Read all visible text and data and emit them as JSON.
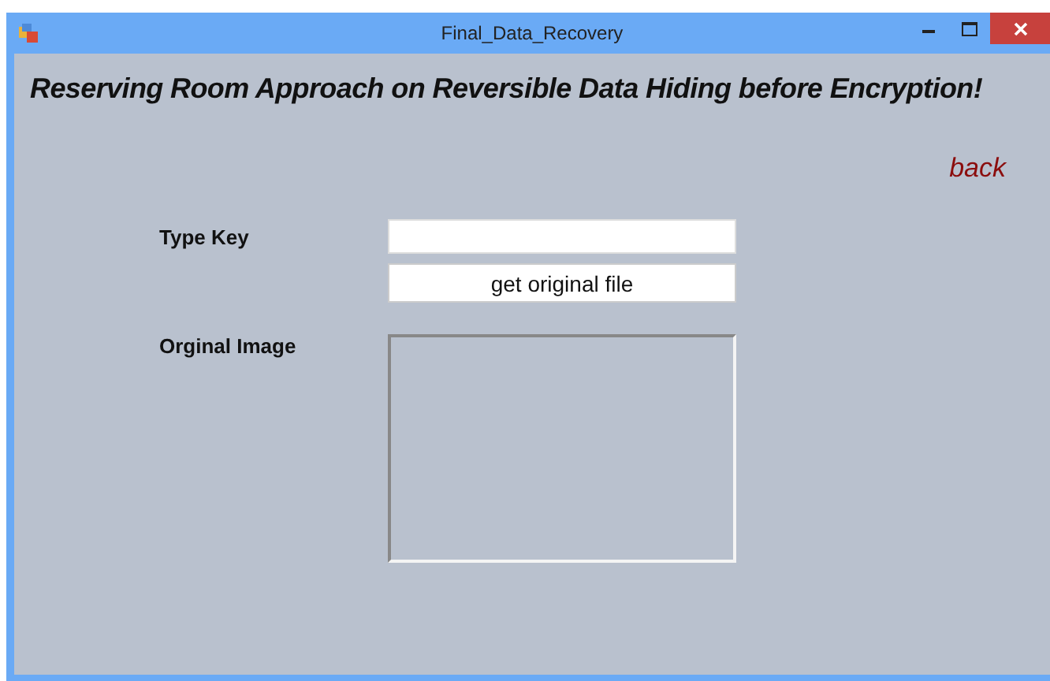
{
  "window": {
    "title": "Final_Data_Recovery"
  },
  "heading": "Reserving Room Approach on Reversible Data Hiding before Encryption!",
  "back_link": "back",
  "key_field": {
    "label": "Type Key"
  },
  "get_button": "get original file",
  "image": {
    "label": "Orginal Image"
  }
}
